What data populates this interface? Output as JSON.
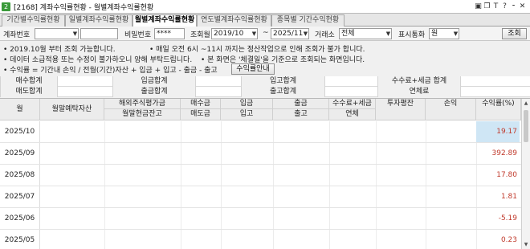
{
  "window": {
    "icon": "2",
    "title": "[2168] 계좌수익률현황 - 월별계좌수익률현황",
    "controls": [
      "▣",
      "❐",
      "T",
      "?",
      "⁃",
      "✕"
    ]
  },
  "tabs": [
    "기간별수익률현황",
    "일별계좌수익률현황",
    "월별계좌수익률현황",
    "연도별계좌수익률현황",
    "종목별 기간수익현황"
  ],
  "search": {
    "account_label": "계좌번호",
    "account_value": "",
    "account_name": "",
    "password_label": "비밀번호",
    "password_value": "****",
    "month_label": "조회월",
    "from_month": "2019/10",
    "tilde": "~",
    "to_month": "2025/11",
    "exchange_label": "거래소",
    "exchange_value": "전체",
    "currency_label": "표시통화",
    "currency_value": "원",
    "query_button": "조회"
  },
  "notices": {
    "line1a": "• 2019.10월 부터 조회 가능합니다.",
    "line1b": "• 매일 오전 6시 ~11시 까지는 정산작업으로 인해 조회가 불가 합니다.",
    "line2a": "• 데이터 소급적용 또는 수정이 불가하오니 양해 부탁드립니다.",
    "line2b": "• 본 화면은 '체결일'을 기준으로 조회되는 화면입니다.",
    "line3": "• 수익률 = 기간내 손익 / 전월(기간)자산 + 입금 + 입고 - 출금 - 출고",
    "info_button": "수익률안내"
  },
  "summary": {
    "buy_total": "매수합계",
    "deposit_total": "입금합계",
    "stock_in_total": "입고합계",
    "fee_tax_total": "수수료+세금 합계",
    "sell_total": "매도합계",
    "withdraw_total": "출금합계",
    "stock_out_total": "출고합계",
    "annual_fee": "연체료"
  },
  "grid": {
    "headers": {
      "month": "월",
      "end_deposit": "월말예탁자산",
      "foreign_eval_top": "해외주식평가금",
      "foreign_eval_bottom": "월말현금잔고",
      "buy": "매수금",
      "sell": "매도금",
      "deposit": "입금",
      "stock_in": "입고",
      "withdraw": "출금",
      "stock_out": "출고",
      "fee_tax": "수수료+세금",
      "overdue": "연체",
      "invest_avg": "투자평잔",
      "pnl": "손익",
      "return": "수익률(%)"
    },
    "rows": [
      {
        "month": "2025/10",
        "return": "19.17"
      },
      {
        "month": "2025/09",
        "return": "392.89"
      },
      {
        "month": "2025/08",
        "return": "17.80"
      },
      {
        "month": "2025/07",
        "return": "1.81"
      },
      {
        "month": "2025/06",
        "return": "-5.19"
      },
      {
        "month": "2025/05",
        "return": "0.23"
      }
    ]
  },
  "colors": {
    "return_value": "#c0392b",
    "selected_cell": "#cfe6f5"
  }
}
